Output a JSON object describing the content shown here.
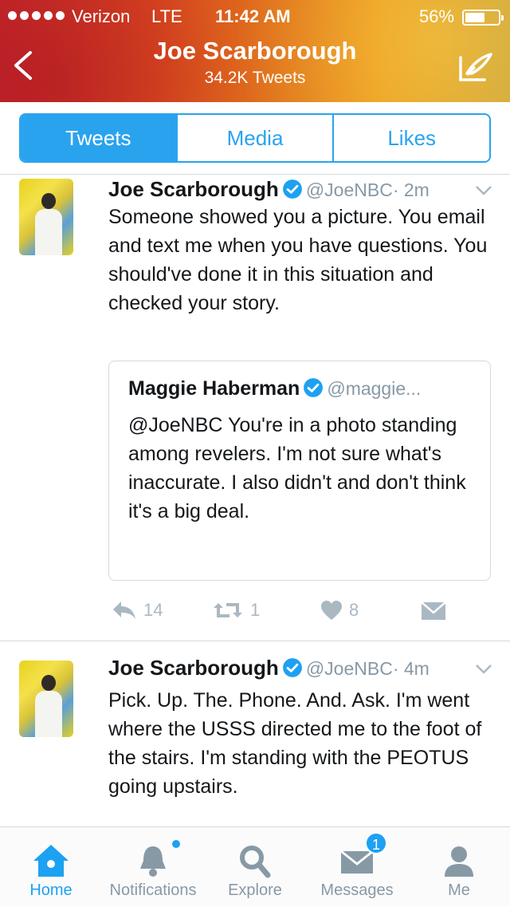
{
  "status": {
    "carrier": "Verizon",
    "network": "LTE",
    "time": "11:42 AM",
    "battery": "56%",
    "battery_level": 0.56
  },
  "header": {
    "title": "Joe Scarborough",
    "subtitle": "34.2K Tweets"
  },
  "tabs": [
    "Tweets",
    "Media",
    "Likes"
  ],
  "tweets": [
    {
      "name": "Joe Scarborough",
      "handle": "@JoeNBC",
      "time": "· 2m",
      "text": "Someone showed you a picture. You email and text me when you have questions. You should've done it in this situation and checked your story.",
      "quote": {
        "name": "Maggie Haberman",
        "handle": "@maggie...",
        "text": "@JoeNBC You're in a photo standing among revelers. I'm not sure what's inaccurate. I also didn't and don't think it's a big deal."
      },
      "replies": "14",
      "retweets": "1",
      "likes": "8"
    },
    {
      "name": "Joe Scarborough",
      "handle": "@JoeNBC",
      "time": "· 4m",
      "text": "Pick. Up. The. Phone. And. Ask. I'm went where the USSS directed me to the foot of the stairs. I'm standing with the PEOTUS going upstairs."
    }
  ],
  "tabbar": {
    "home": "Home",
    "notifications": "Notifications",
    "explore": "Explore",
    "messages": "Messages",
    "messages_badge": "1",
    "me": "Me"
  },
  "colors": {
    "accent": "#1da1f2",
    "muted": "#8899a6"
  }
}
